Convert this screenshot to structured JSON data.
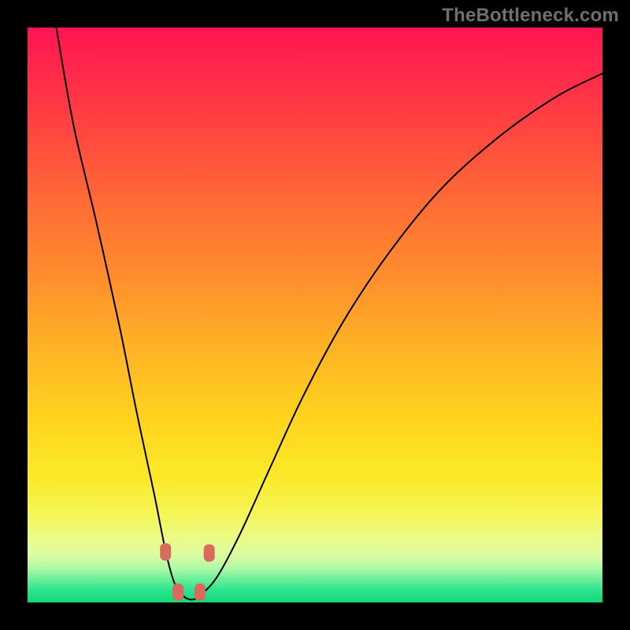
{
  "watermark": "TheBottleneck.com",
  "palette": {
    "frame": "#000000",
    "curve": "#000000",
    "marker": "#d86a60",
    "gradient_top": "#ff1452",
    "gradient_bottom": "#14d877"
  },
  "chart_data": {
    "type": "line",
    "title": "",
    "xlabel": "",
    "ylabel": "",
    "xlim": [
      0,
      100
    ],
    "ylim": [
      0,
      100
    ],
    "note": "No axes or numeric tick labels are rendered in the source image; x/y values below are normalized screen-space estimates (0–100) read off the pixel geometry.",
    "series": [
      {
        "name": "bottleneck-curve",
        "x": [
          5,
          8,
          12,
          16,
          19,
          22,
          24,
          25.5,
          27,
          28.5,
          30,
          33,
          37,
          42,
          48,
          55,
          63,
          72,
          82,
          92,
          100
        ],
        "y": [
          100,
          83,
          66,
          48,
          33,
          19,
          9,
          3.5,
          1.2,
          0.5,
          1.2,
          4.5,
          12,
          23,
          36,
          49,
          61,
          72,
          81,
          88,
          92
        ]
      }
    ],
    "markers": [
      {
        "x": 24.0,
        "y": 8.8
      },
      {
        "x": 26.2,
        "y": 1.8
      },
      {
        "x": 30.0,
        "y": 1.8
      },
      {
        "x": 31.6,
        "y": 8.6
      }
    ],
    "marker_shape": "rounded-rect"
  }
}
